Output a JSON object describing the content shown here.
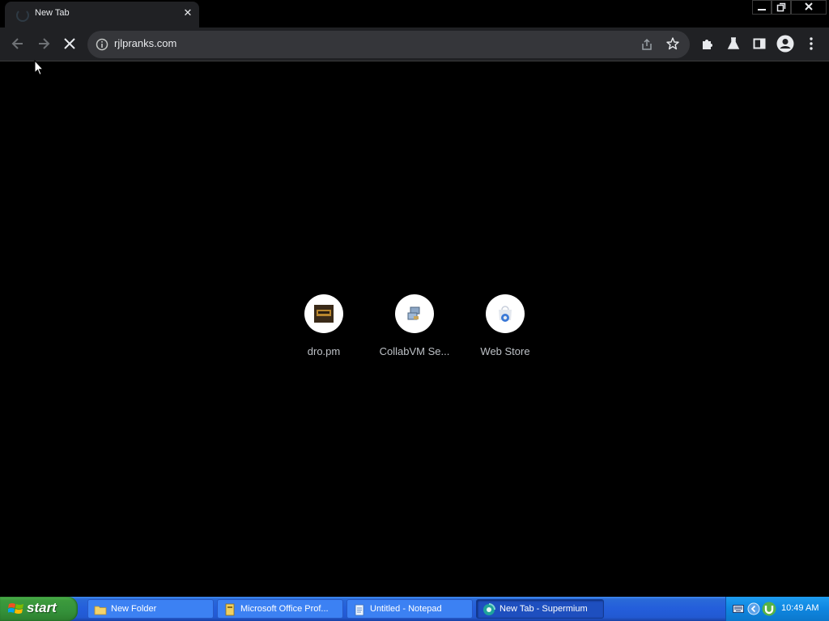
{
  "browser": {
    "tab": {
      "title": "New Tab"
    },
    "address_bar": {
      "url": "rjlpranks.com"
    },
    "shortcuts": [
      {
        "label": "dro.pm"
      },
      {
        "label": "CollabVM Se..."
      },
      {
        "label": "Web Store"
      }
    ]
  },
  "taskbar": {
    "start_label": "start",
    "tasks": [
      {
        "label": "New Folder",
        "active": false
      },
      {
        "label": "Microsoft Office Prof...",
        "active": false
      },
      {
        "label": "Untitled - Notepad",
        "active": false
      },
      {
        "label": "New Tab - Supermium",
        "active": true
      }
    ],
    "clock": "10:49 AM"
  },
  "colors": {
    "chrome_dark": "#202124",
    "omnibox": "#35363a",
    "xp_taskbar": "#245edb",
    "xp_start": "#3c9a3c"
  }
}
